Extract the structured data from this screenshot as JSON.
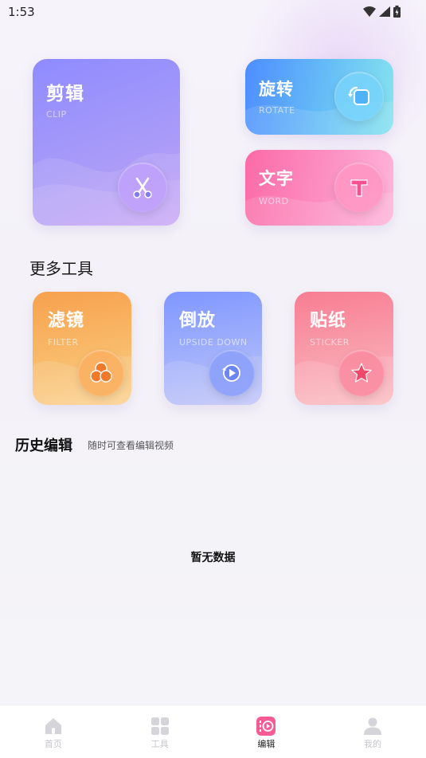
{
  "status_bar": {
    "time": "1:53"
  },
  "main_tools": {
    "clip": {
      "title": "剪辑",
      "subtitle": "CLIP"
    },
    "rotate": {
      "title": "旋转",
      "subtitle": "ROTATE"
    },
    "word": {
      "title": "文字",
      "subtitle": "WORD"
    }
  },
  "more_tools": {
    "title": "更多工具",
    "items": [
      {
        "title": "滤镜",
        "subtitle": "FILTER"
      },
      {
        "title": "倒放",
        "subtitle": "UPSIDE DOWN"
      },
      {
        "title": "贴纸",
        "subtitle": "STICKER"
      }
    ]
  },
  "history": {
    "title": "历史编辑",
    "subtitle": "随时可查看编辑视频",
    "empty_text": "暂无数据"
  },
  "tabbar": {
    "items": [
      {
        "label": "首页",
        "icon": "home-icon",
        "active": false
      },
      {
        "label": "工具",
        "icon": "grid-icon",
        "active": false
      },
      {
        "label": "编辑",
        "icon": "video-edit-icon",
        "active": true
      },
      {
        "label": "我的",
        "icon": "user-icon",
        "active": false
      }
    ]
  },
  "colors": {
    "clip": "#8f8bff",
    "rotate": "#4d8dff",
    "word": "#fb6aa7",
    "filter": "#f7a14e",
    "upside_down": "#7f97ff",
    "sticker": "#f77d92",
    "active_tab": "#f75b95"
  }
}
